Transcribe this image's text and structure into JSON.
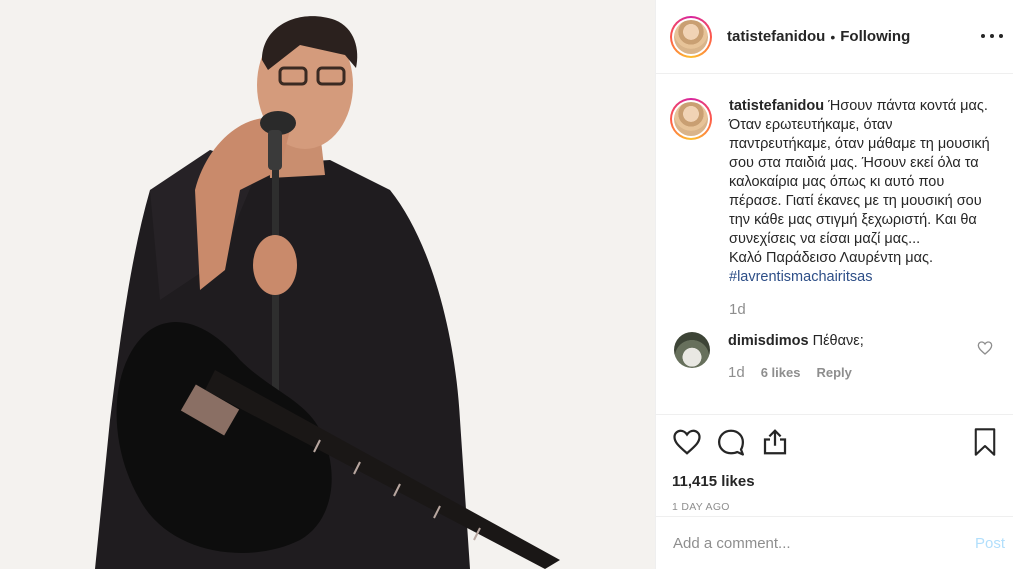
{
  "post": {
    "photo_icon": "concert-photo-man-with-guitar"
  },
  "header": {
    "username": "tatistefanidou",
    "separator": "•",
    "follow_status": "Following",
    "more_icon": "more-options-icon"
  },
  "caption": {
    "username": "tatistefanidou",
    "lines": [
      "Ήσουν πάντα κοντά μας. Όταν ερωτευτήκαμε, όταν παντρευτήκαμε, όταν μάθαμε τη μουσική σου στα παιδιά μας. Ήσουν εκεί όλα τα καλοκαίρια μας όπως κι αυτό που πέρασε. Γιατί έκανες με τη μουσική σου την κάθε μας στιγμή ξεχωριστή. Και θα συνεχίσεις να είσαι μαζί μας...",
      "Καλό Παράδεισο Λαυρέντη μας."
    ],
    "hashtag": "#lavrentismachairitsas",
    "time": "1d"
  },
  "comments": [
    {
      "username": "dimisdimos",
      "text": "Πέθανε;",
      "time": "1d",
      "likes": "6 likes",
      "reply": "Reply"
    }
  ],
  "actions": {
    "likes_count": "11,415 likes",
    "date_ago": "1 DAY AGO"
  },
  "add_comment": {
    "placeholder": "Add a comment...",
    "post_label": "Post"
  },
  "colors": {
    "hashtag": "#2d4e87",
    "post_disabled": "#b2dffc",
    "muted": "#8e8e8e"
  }
}
